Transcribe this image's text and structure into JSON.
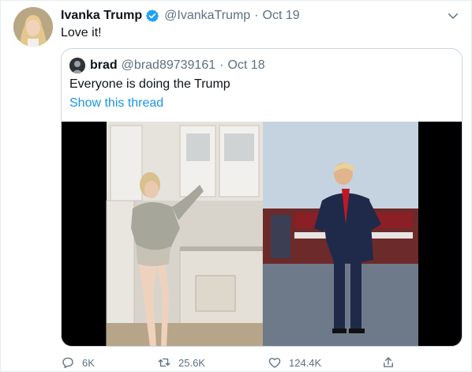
{
  "tweet": {
    "author_name": "Ivanka Trump",
    "author_handle": "@IvankaTrump",
    "separator": "·",
    "date": "Oct 19",
    "text": "Love it!",
    "verified_icon": "verified-badge-icon",
    "menu_icon": "chevron-down-icon"
  },
  "quoted_tweet": {
    "author_name": "brad",
    "author_handle": "@brad89739161",
    "separator": "·",
    "date": "Oct 18",
    "text": "Everyone is doing the Trump",
    "thread_link": "Show this thread"
  },
  "actions": {
    "reply_count": "6K",
    "retweet_count": "25.6K",
    "like_count": "124.4K"
  },
  "colors": {
    "link": "#1b95e0",
    "verified": "#1da1f2",
    "secondary_text": "#5b7083",
    "border": "#ccd6dd"
  }
}
